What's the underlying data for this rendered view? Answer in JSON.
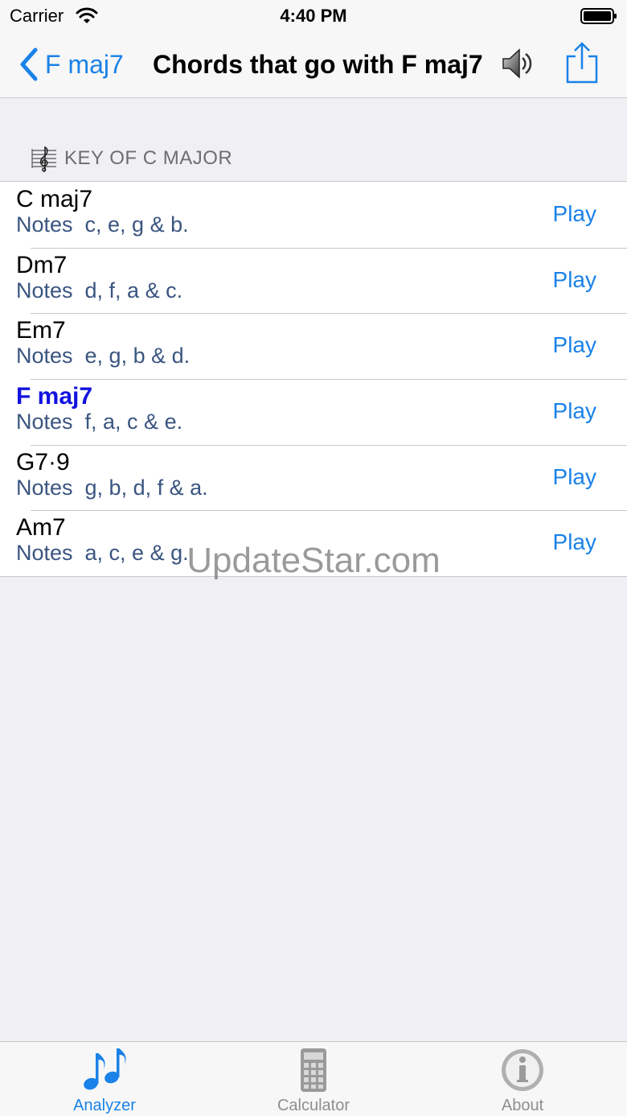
{
  "status_bar": {
    "carrier": "Carrier",
    "time": "4:40 PM"
  },
  "nav": {
    "back_label": "F maj7",
    "title": "Chords that go with F maj7",
    "speaker_icon": "speaker-icon",
    "share_icon": "share-icon"
  },
  "section": {
    "icon": "staff-icon",
    "label": "KEY OF C MAJOR"
  },
  "chords": [
    {
      "name": "C maj7",
      "notes": "Notes  c, e, g & b.",
      "play": "Play",
      "active": false
    },
    {
      "name": "Dm7",
      "notes": "Notes  d, f, a & c.",
      "play": "Play",
      "active": false
    },
    {
      "name": "Em7",
      "notes": "Notes  e, g, b & d.",
      "play": "Play",
      "active": false
    },
    {
      "name": "F maj7",
      "notes": "Notes  f, a, c & e.",
      "play": "Play",
      "active": true
    },
    {
      "name": "G7·9",
      "notes": "Notes  g, b, d, f & a.",
      "play": "Play",
      "active": false
    },
    {
      "name": "Am7",
      "notes": "Notes  a, c, e & g.",
      "play": "Play",
      "active": false
    }
  ],
  "watermark": "UpdateStar.com",
  "tabs": [
    {
      "label": "Analyzer",
      "icon": "music-notes-icon",
      "selected": true
    },
    {
      "label": "Calculator",
      "icon": "calculator-icon",
      "selected": false
    },
    {
      "label": "About",
      "icon": "info-icon",
      "selected": false
    }
  ],
  "colors": {
    "accent": "#1a82e8",
    "active_chord": "#1212e0",
    "notes_text": "#3a5580"
  }
}
